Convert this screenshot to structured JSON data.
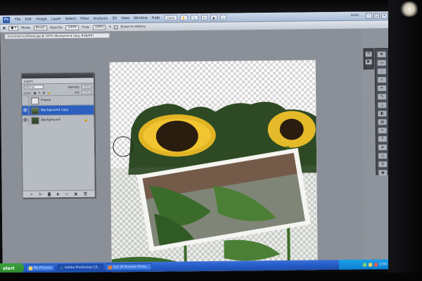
{
  "menubar": {
    "logo": "Ps",
    "items": [
      "File",
      "Edit",
      "Image",
      "Layer",
      "Select",
      "Filter",
      "Analysis",
      "3D",
      "View",
      "Window",
      "Help"
    ],
    "zoom": "100%",
    "workspace": "BASIC"
  },
  "options": {
    "mode_label": "Mode:",
    "mode_value": "Brush",
    "opacity_label": "Opacity:",
    "opacity_value": "100%",
    "flow_label": "Flow:",
    "flow_value": "100%",
    "erase_to_history": "Erase to History"
  },
  "document": {
    "tab_title": "Unnamed-sunflower.jpg @ 100% (Background copy, RGB/8#)"
  },
  "layers_panel": {
    "tab_label": "Layers",
    "blend_mode": "Normal",
    "opacity_label": "Opacity:",
    "opacity_value": "100%",
    "lock_label": "Lock:",
    "fill_label": "Fill:",
    "fill_value": "100%",
    "layers": [
      {
        "name": "Frame",
        "selected": false,
        "locked": false
      },
      {
        "name": "Background copy",
        "selected": true,
        "locked": false
      },
      {
        "name": "Background",
        "selected": false,
        "locked": true
      }
    ]
  },
  "taskbar": {
    "start_label": "start",
    "tasks": [
      "My Pictures",
      "Adobe Photoshop CS...",
      "Out Of Bounds Photo..."
    ],
    "clock": "2:55 PM"
  },
  "colors": {
    "selected_layer": "#2d5fbf",
    "taskbar": "#245cc9",
    "start_button": "#2c8a2c"
  }
}
